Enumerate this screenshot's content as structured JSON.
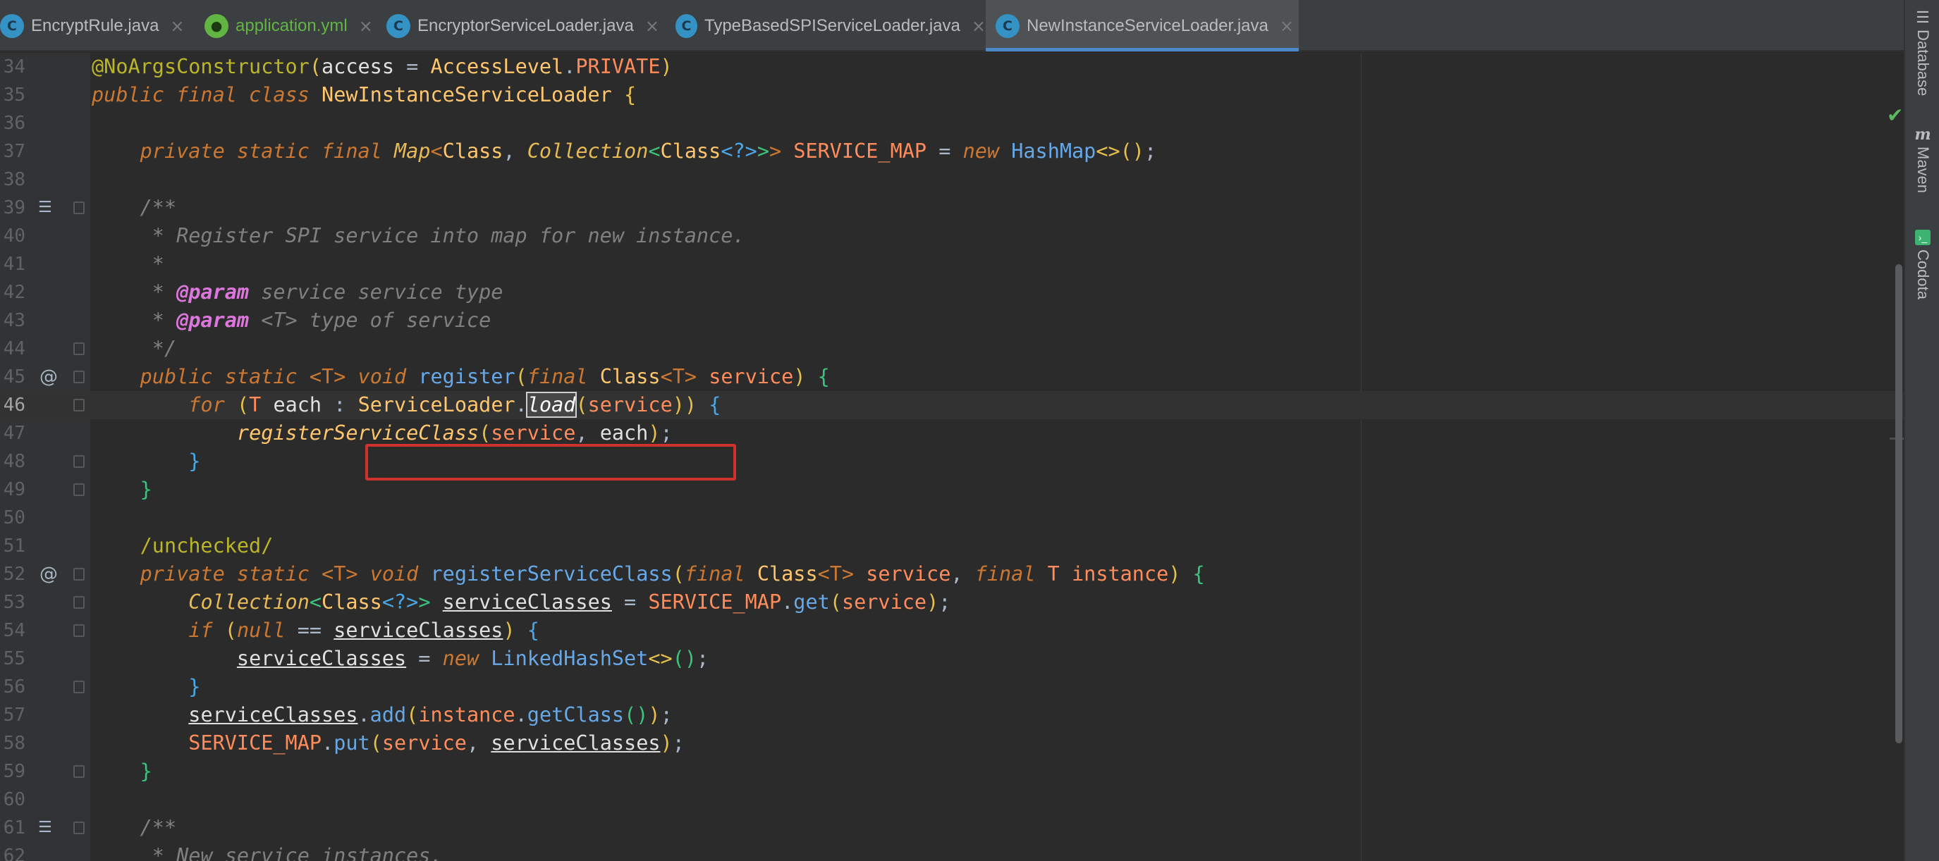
{
  "tabs": [
    {
      "label": "EncryptRule.java",
      "icon": "java-class-icon",
      "active": false
    },
    {
      "label": "application.yml",
      "icon": "yaml-file-icon",
      "active": false
    },
    {
      "label": "EncryptorServiceLoader.java",
      "icon": "java-class-icon",
      "active": false
    },
    {
      "label": "TypeBasedSPIServiceLoader.java",
      "icon": "java-class-icon",
      "active": false
    },
    {
      "label": "NewInstanceServiceLoader.java",
      "icon": "java-class-icon",
      "active": true
    }
  ],
  "right_panel": {
    "database_label": "Database",
    "maven_label": "Maven",
    "codota_label": "Codota"
  },
  "editor": {
    "line_numbers": [
      "34",
      "35",
      "36",
      "37",
      "38",
      "39",
      "40",
      "41",
      "42",
      "43",
      "44",
      "45",
      "46",
      "47",
      "48",
      "49",
      "50",
      "51",
      "52",
      "53",
      "54",
      "55",
      "56",
      "57",
      "58",
      "59",
      "60",
      "61",
      "62"
    ],
    "current_line": "46",
    "highlighted_expression": "ServiceLoader.load(service)",
    "selected_word": "load"
  },
  "colors": {
    "editor_bg": "#2b2b2b",
    "keyword": "#cc7832",
    "annotation": "#bbb529",
    "comment": "#808080",
    "highlight_box": "#d0312d",
    "active_tab_underline": "#4a88c7"
  }
}
